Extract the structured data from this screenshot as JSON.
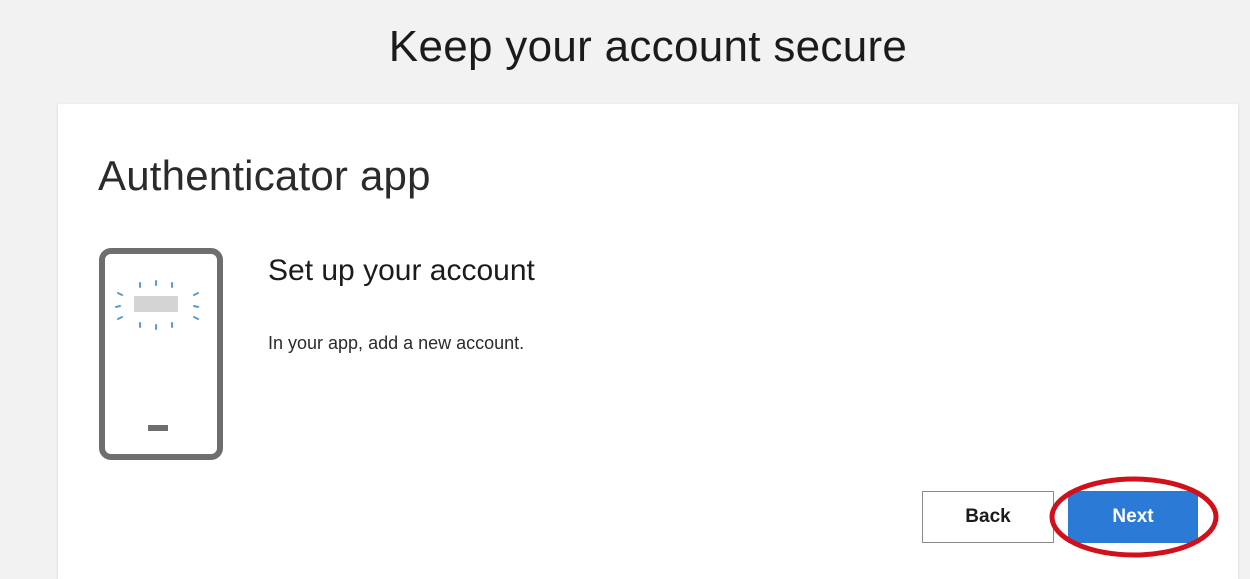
{
  "page": {
    "title": "Keep your account secure"
  },
  "card": {
    "method_title": "Authenticator app",
    "step_title": "Set up your account",
    "step_text": "In your app, add a new account."
  },
  "buttons": {
    "back_label": "Back",
    "next_label": "Next"
  },
  "icons": {
    "illustration": "phone-icon"
  },
  "colors": {
    "primary_button": "#2a7ad6",
    "highlight_ring": "#d0101b",
    "phone_outline": "#6e6e6e",
    "sparkle": "#5b9bd5"
  }
}
